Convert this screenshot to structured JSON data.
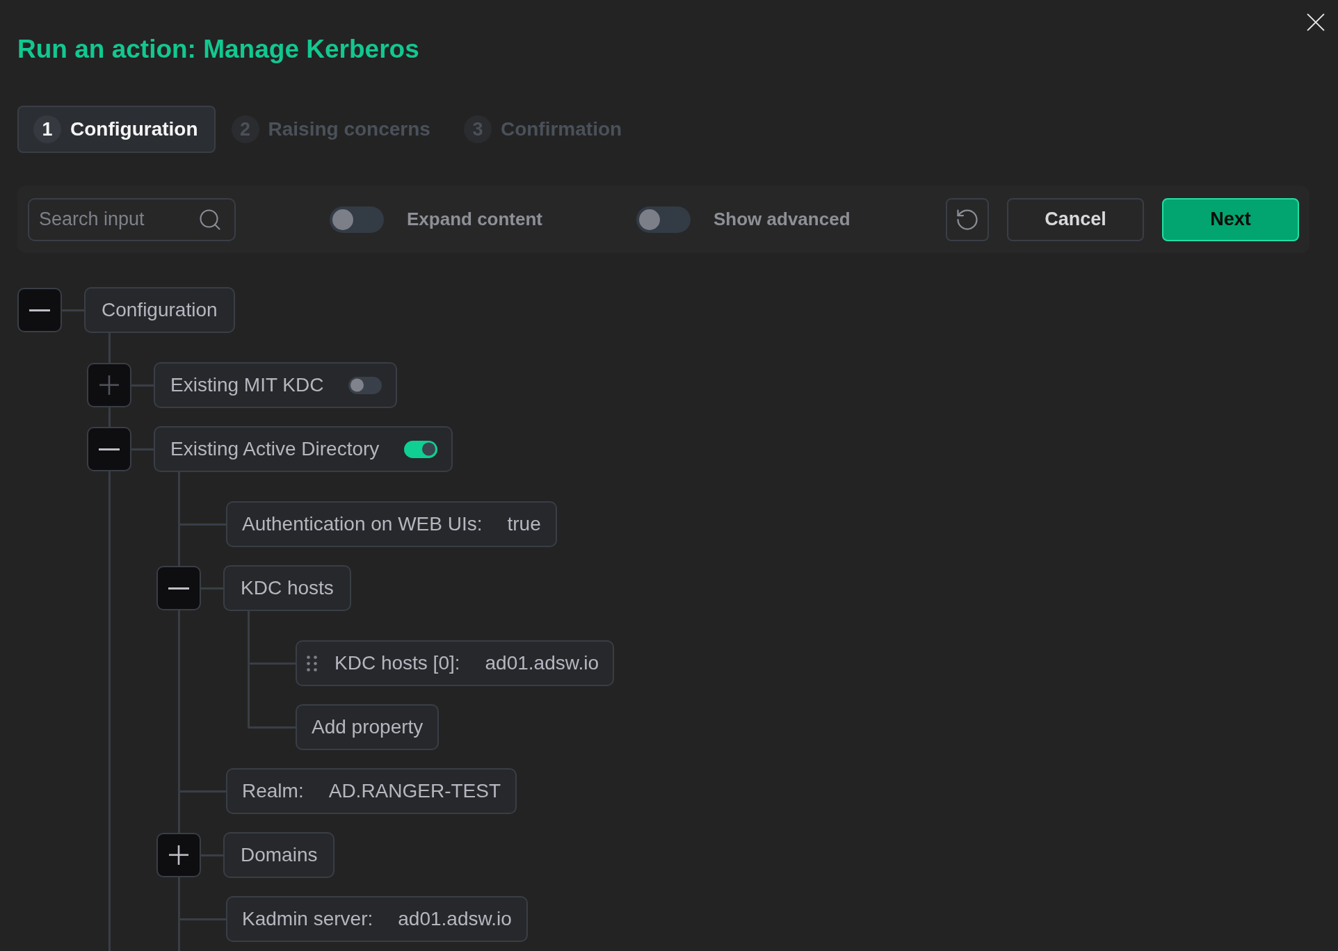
{
  "dialog": {
    "title": "Run an action: Manage Kerberos"
  },
  "steps": [
    {
      "number": "1",
      "label": "Configuration",
      "selected": true
    },
    {
      "number": "2",
      "label": "Raising concerns",
      "selected": false
    },
    {
      "number": "3",
      "label": "Confirmation",
      "selected": false
    }
  ],
  "toolbar": {
    "search": {
      "placeholder": "Search input"
    },
    "switches": [
      {
        "label": "Expand content",
        "on": false
      },
      {
        "label": "Show advanced",
        "on": false
      }
    ],
    "buttons": [
      {
        "kind": "secondary",
        "label": "Cancel"
      },
      {
        "kind": "primary",
        "label": "Next"
      }
    ]
  },
  "tree": {
    "kind": "group",
    "label": "Configuration",
    "expanded": true,
    "disabled": false,
    "children": [
      {
        "kind": "group",
        "label": "Existing MIT KDC",
        "switch": {
          "on": false
        },
        "expanded": false,
        "disabled": true
      },
      {
        "kind": "group",
        "label": "Existing Active Directory",
        "switch": {
          "on": true
        },
        "expanded": true,
        "disabled": false,
        "children": [
          {
            "kind": "field",
            "label": "Authentication on WEB UIs:",
            "value": "true"
          },
          {
            "kind": "group",
            "label": "KDC hosts",
            "expanded": true,
            "disabled": false,
            "children": [
              {
                "kind": "item",
                "label": "KDC hosts [0]:",
                "value": "ad01.adsw.io"
              },
              {
                "kind": "add",
                "label": "Add property"
              }
            ]
          },
          {
            "kind": "field",
            "label": "Realm:",
            "value": "AD.RANGER-TEST"
          },
          {
            "kind": "group",
            "label": "Domains",
            "expanded": false,
            "disabled": false
          },
          {
            "kind": "field",
            "label": "Kadmin server:",
            "value": "ad01.adsw.io"
          }
        ]
      }
    ]
  }
}
